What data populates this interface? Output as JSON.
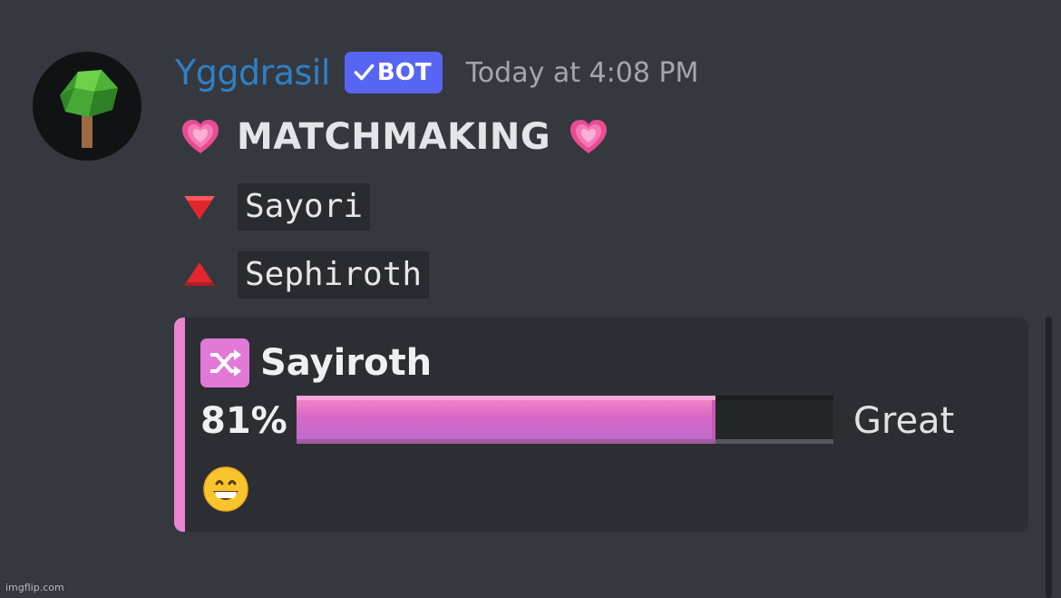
{
  "message": {
    "author": "Yggdrasil",
    "badge": "BOT",
    "timestamp": "Today at 4:08 PM",
    "avatar_icon": "tree-icon",
    "title": "MATCHMAKING",
    "title_icon": "growing-heart-icon",
    "lines": [
      {
        "icon": "down-triangle-icon",
        "name": "Sayori"
      },
      {
        "icon": "up-triangle-icon",
        "name": "Sephiroth"
      }
    ]
  },
  "embed": {
    "accent_color": "#ea84cf",
    "icon": "shuffle-icon",
    "title": "Sayiroth",
    "percent_label": "81%",
    "match_fraction": 0.78,
    "rating": "Great",
    "reaction_icon": "grinning-face-icon"
  },
  "colors": {
    "background": "#36383f",
    "username": "#2f80c4",
    "bot_badge": "#5865f2"
  },
  "watermark": "imgflip.com"
}
